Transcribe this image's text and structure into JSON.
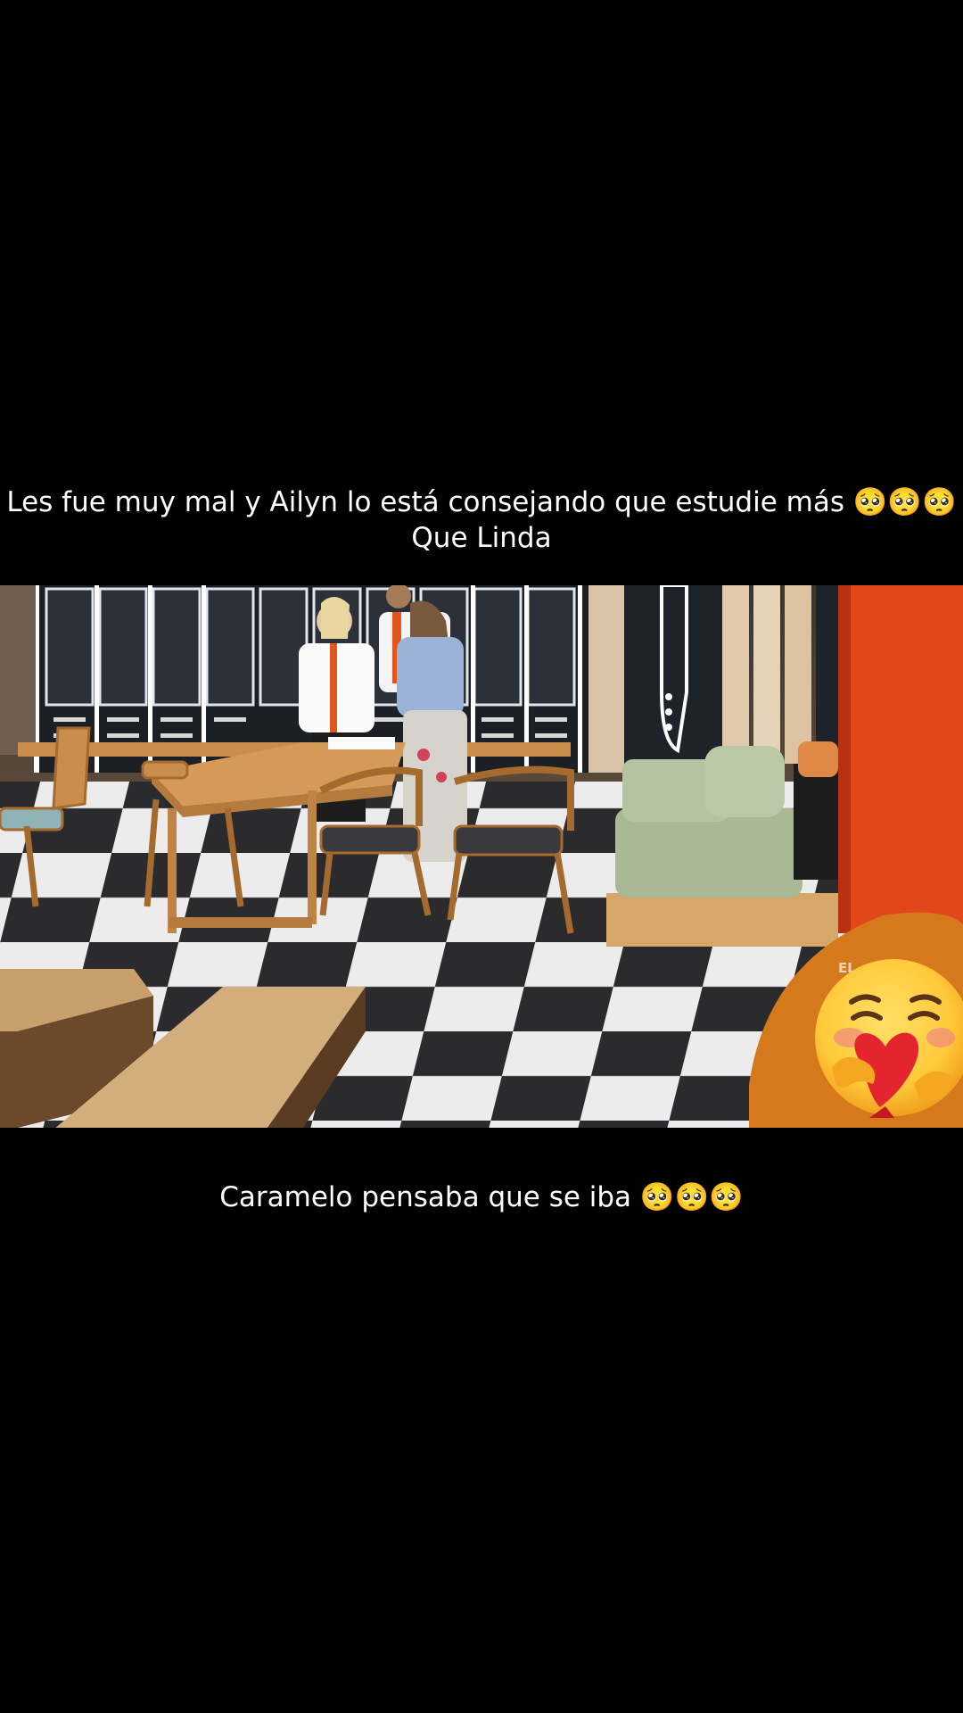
{
  "captions": {
    "top_line_1": "Les fue muy mal  y Ailyn lo está consejando que estudie más 🥺🥺🥺",
    "top_line_2": "Que Linda",
    "bottom": "Caramelo pensaba que se iba 🥺🥺🥺"
  },
  "video": {
    "watermark": "EL... LOS",
    "colors": {
      "floor_dark": "#2b2b2e",
      "floor_light": "#ececec",
      "wood": "#c98d4c",
      "sofa": "#a9b996",
      "red_panel": "#e2461a",
      "locker": "#1c1f24"
    }
  },
  "sticker": {
    "icon": "face-holding-back-tears-hugging-heart-icon",
    "colors": {
      "face": "#ffc93a",
      "heart": "#e4252f"
    }
  }
}
